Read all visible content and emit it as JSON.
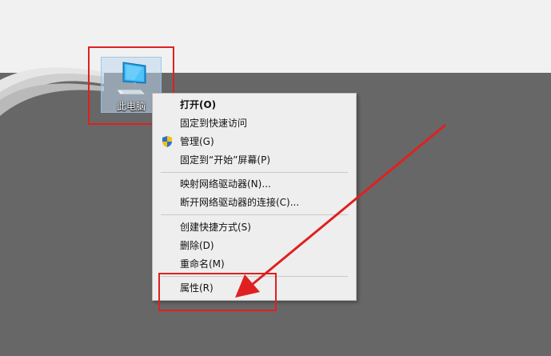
{
  "desktop_icon": {
    "label": "此电脑"
  },
  "context_menu": {
    "items": [
      {
        "label": "打开(O)"
      },
      {
        "label": "固定到快速访问"
      },
      {
        "label": "管理(G)"
      },
      {
        "label": "固定到“开始”屏幕(P)"
      },
      {
        "label": "映射网络驱动器(N)..."
      },
      {
        "label": "断开网络驱动器的连接(C)..."
      },
      {
        "label": "创建快捷方式(S)"
      },
      {
        "label": "删除(D)"
      },
      {
        "label": "重命名(M)"
      },
      {
        "label": "属性(R)"
      }
    ]
  },
  "colors": {
    "desktop": "#676767",
    "menu_bg": "#eeeeee",
    "annotation": "#e02020",
    "icon_selection": "#bed7f0"
  }
}
